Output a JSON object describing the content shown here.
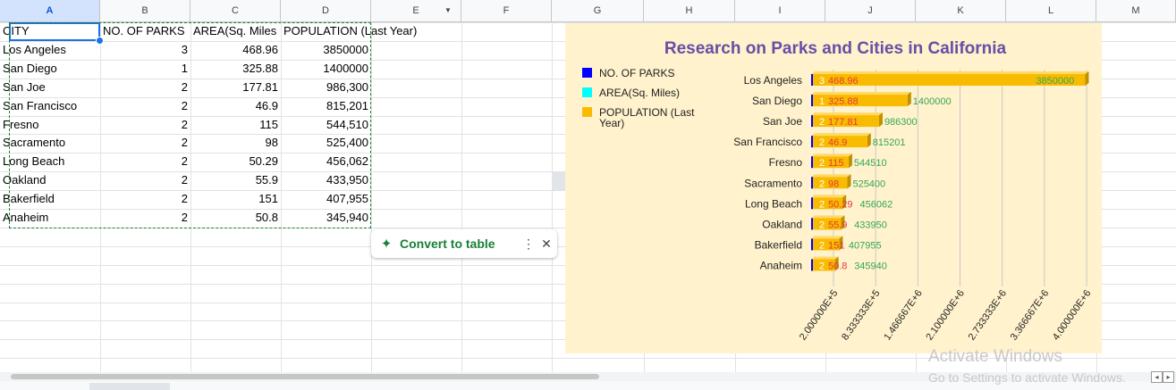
{
  "columns": [
    "A",
    "B",
    "C",
    "D",
    "E",
    "F",
    "G",
    "H",
    "I",
    "J",
    "K",
    "L",
    "M"
  ],
  "table": {
    "headers": [
      "CITY",
      "NO. OF PARKS",
      "AREA(Sq. Miles",
      "POPULATION (Last Year)"
    ],
    "rows": [
      [
        "Los Angeles",
        "3",
        "468.96",
        "3850000"
      ],
      [
        "San Diego",
        "1",
        "325.88",
        "1400000"
      ],
      [
        "San Joe",
        "2",
        "177.81",
        "986,300"
      ],
      [
        "San Francisco",
        "2",
        "46.9",
        "815,201"
      ],
      [
        "Fresno",
        "2",
        "115",
        "544,510"
      ],
      [
        "Sacramento",
        "2",
        "98",
        "525,400"
      ],
      [
        "Long Beach",
        "2",
        "50.29",
        "456,062"
      ],
      [
        "Oakland",
        "2",
        "55.9",
        "433,950"
      ],
      [
        "Bakerfield",
        "2",
        "151",
        "407,955"
      ],
      [
        "Anaheim",
        "2",
        "50.8",
        "345,940"
      ]
    ]
  },
  "chip": {
    "label": "Convert to table",
    "more": "⋮",
    "close": "✕",
    "spark": "✦"
  },
  "watermark": {
    "line1": "Activate Windows",
    "line2": "Go to Settings to activate Windows."
  },
  "chart_data": {
    "type": "bar",
    "orientation": "horizontal",
    "title": "Research on Parks and Cities in California",
    "categories": [
      "Los Angeles",
      "San Diego",
      "San Joe",
      "San Francisco",
      "Fresno",
      "Sacramento",
      "Long Beach",
      "Oakland",
      "Bakerfield",
      "Anaheim"
    ],
    "series": [
      {
        "name": "NO. OF PARKS",
        "values": [
          3,
          1,
          2,
          2,
          2,
          2,
          2,
          2,
          2,
          2
        ],
        "color": "#0000ff",
        "label_color": "#ffffff"
      },
      {
        "name": "AREA(Sq. Miles)",
        "values": [
          468.96,
          325.88,
          177.81,
          46.9,
          115,
          98,
          50.29,
          55.9,
          151,
          50.8
        ],
        "color": "#00ffff",
        "label_color": "#e53935"
      },
      {
        "name": "POPULATION (Last Year)",
        "values": [
          3850000,
          1400000,
          986300,
          815201,
          544510,
          525400,
          456062,
          433950,
          407955,
          345940
        ],
        "color": "#f9bb00",
        "label_color": "#34a853"
      }
    ],
    "x_ticks": [
      "2.000000E+5",
      "8.333333E+5",
      "1.466667E+6",
      "2.100000E+6",
      "2.733333E+6",
      "3.366667E+6",
      "4.000000E+6"
    ],
    "xlim": [
      0,
      4000000
    ],
    "legend_position": "left",
    "grid": true,
    "colors": {
      "background": "#fff2cc",
      "title": "#674ea7",
      "bar_edge": "#bf9000"
    }
  }
}
